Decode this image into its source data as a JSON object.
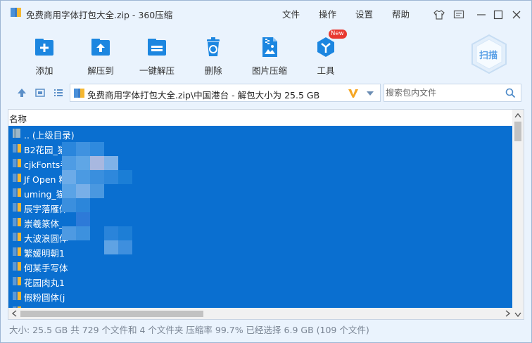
{
  "window": {
    "title": "免费商用字体打包大全.zip - 360压缩"
  },
  "menu": {
    "file": "文件",
    "operate": "操作",
    "settings": "设置",
    "help": "帮助"
  },
  "toolbar": {
    "add": "添加",
    "extract_to": "解压到",
    "one_click": "一键解压",
    "delete": "删除",
    "image_compress": "图片压缩",
    "tools": "工具",
    "new_badge": "New",
    "scan": "扫描"
  },
  "address": {
    "path": "免费商用字体打包大全.zip\\中国港台 - 解包大小为 25.5 GB"
  },
  "search": {
    "placeholder": "搜索包内文件"
  },
  "file_list": {
    "column_name": "名称",
    "rows": [
      {
        "name": ".. (上级目录)"
      },
      {
        "name": "B2花园_猫"
      },
      {
        "name": "cjkFonts手"
      },
      {
        "name": "Jf Open 粉"
      },
      {
        "name": "uming_猫"
      },
      {
        "name": "辰宇落雁体"
      },
      {
        "name": "崇羲篆体_"
      },
      {
        "name": "大波浪圆体"
      },
      {
        "name": "繁媛明朝1"
      },
      {
        "name": "何某手写体"
      },
      {
        "name": "花园肉丸1"
      },
      {
        "name": "假粉圆体(j"
      },
      {
        "name": ""
      }
    ]
  },
  "status": {
    "text": "大小: 25.5 GB 共 729 个文件和 4 个文件夹 压缩率 99.7% 已经选择 6.9 GB (109 个文件)"
  },
  "colors": {
    "selection": "#0a6fd0",
    "background": "#eaf3fd",
    "icon_blue": "#1c86e0"
  }
}
